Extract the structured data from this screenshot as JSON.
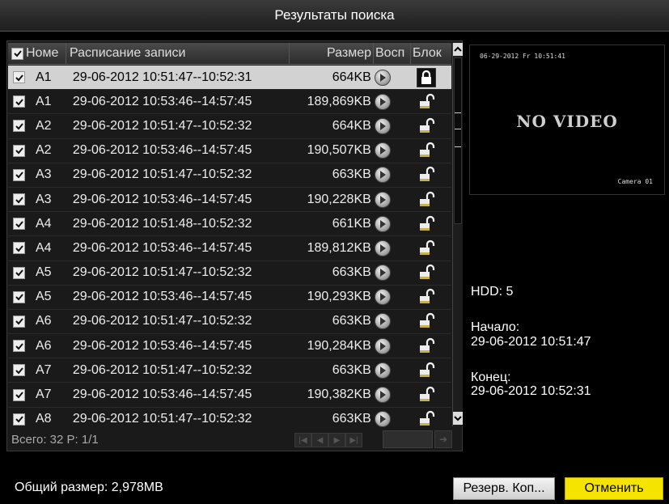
{
  "window": {
    "title": "Результаты поиска"
  },
  "table": {
    "headers": {
      "no": "Номе",
      "schedule": "Расписание записи",
      "size": "Размер",
      "play": "Восп",
      "lock": "Блок"
    },
    "rows": [
      {
        "cam": "A1",
        "schedule": "29-06-2012 10:51:47--10:52:31",
        "size": "664KB",
        "locked": true,
        "selected": true
      },
      {
        "cam": "A1",
        "schedule": "29-06-2012 10:53:46--14:57:45",
        "size": "189,869KB",
        "locked": false,
        "selected": false
      },
      {
        "cam": "A2",
        "schedule": "29-06-2012 10:51:47--10:52:32",
        "size": "664KB",
        "locked": false,
        "selected": false
      },
      {
        "cam": "A2",
        "schedule": "29-06-2012 10:53:46--14:57:45",
        "size": "190,507KB",
        "locked": false,
        "selected": false
      },
      {
        "cam": "A3",
        "schedule": "29-06-2012 10:51:47--10:52:32",
        "size": "663KB",
        "locked": false,
        "selected": false
      },
      {
        "cam": "A3",
        "schedule": "29-06-2012 10:53:46--14:57:45",
        "size": "190,228KB",
        "locked": false,
        "selected": false
      },
      {
        "cam": "A4",
        "schedule": "29-06-2012 10:51:48--10:52:32",
        "size": "661KB",
        "locked": false,
        "selected": false
      },
      {
        "cam": "A4",
        "schedule": "29-06-2012 10:53:46--14:57:45",
        "size": "189,812KB",
        "locked": false,
        "selected": false
      },
      {
        "cam": "A5",
        "schedule": "29-06-2012 10:51:47--10:52:32",
        "size": "663KB",
        "locked": false,
        "selected": false
      },
      {
        "cam": "A5",
        "schedule": "29-06-2012 10:53:46--14:57:45",
        "size": "190,293KB",
        "locked": false,
        "selected": false
      },
      {
        "cam": "A6",
        "schedule": "29-06-2012 10:51:47--10:52:32",
        "size": "663KB",
        "locked": false,
        "selected": false
      },
      {
        "cam": "A6",
        "schedule": "29-06-2012 10:53:46--14:57:45",
        "size": "190,284KB",
        "locked": false,
        "selected": false
      },
      {
        "cam": "A7",
        "schedule": "29-06-2012 10:51:47--10:52:32",
        "size": "663KB",
        "locked": false,
        "selected": false
      },
      {
        "cam": "A7",
        "schedule": "29-06-2012 10:53:46--14:57:45",
        "size": "190,382KB",
        "locked": false,
        "selected": false
      },
      {
        "cam": "A8",
        "schedule": "29-06-2012 10:51:47--10:52:32",
        "size": "663KB",
        "locked": false,
        "selected": false
      }
    ]
  },
  "pager": {
    "text": "Всего: 32  P: 1/1"
  },
  "preview": {
    "timestamp": "06-29-2012 Fr 10:51:41",
    "no_video": "NO VIDEO",
    "camera": "Camera 01"
  },
  "info": {
    "hdd": "HDD: 5",
    "start_label": "Начало:",
    "start_value": "29-06-2012 10:51:47",
    "end_label": "Конец:",
    "end_value": "29-06-2012 10:52:31"
  },
  "footer": {
    "total_size": "Общий размер: 2,978MB",
    "backup_label": "Резерв. Коп...",
    "cancel_label": "Отменить"
  },
  "colors": {
    "accent": "#f5e400",
    "selected_row": "#d2d2d2"
  }
}
